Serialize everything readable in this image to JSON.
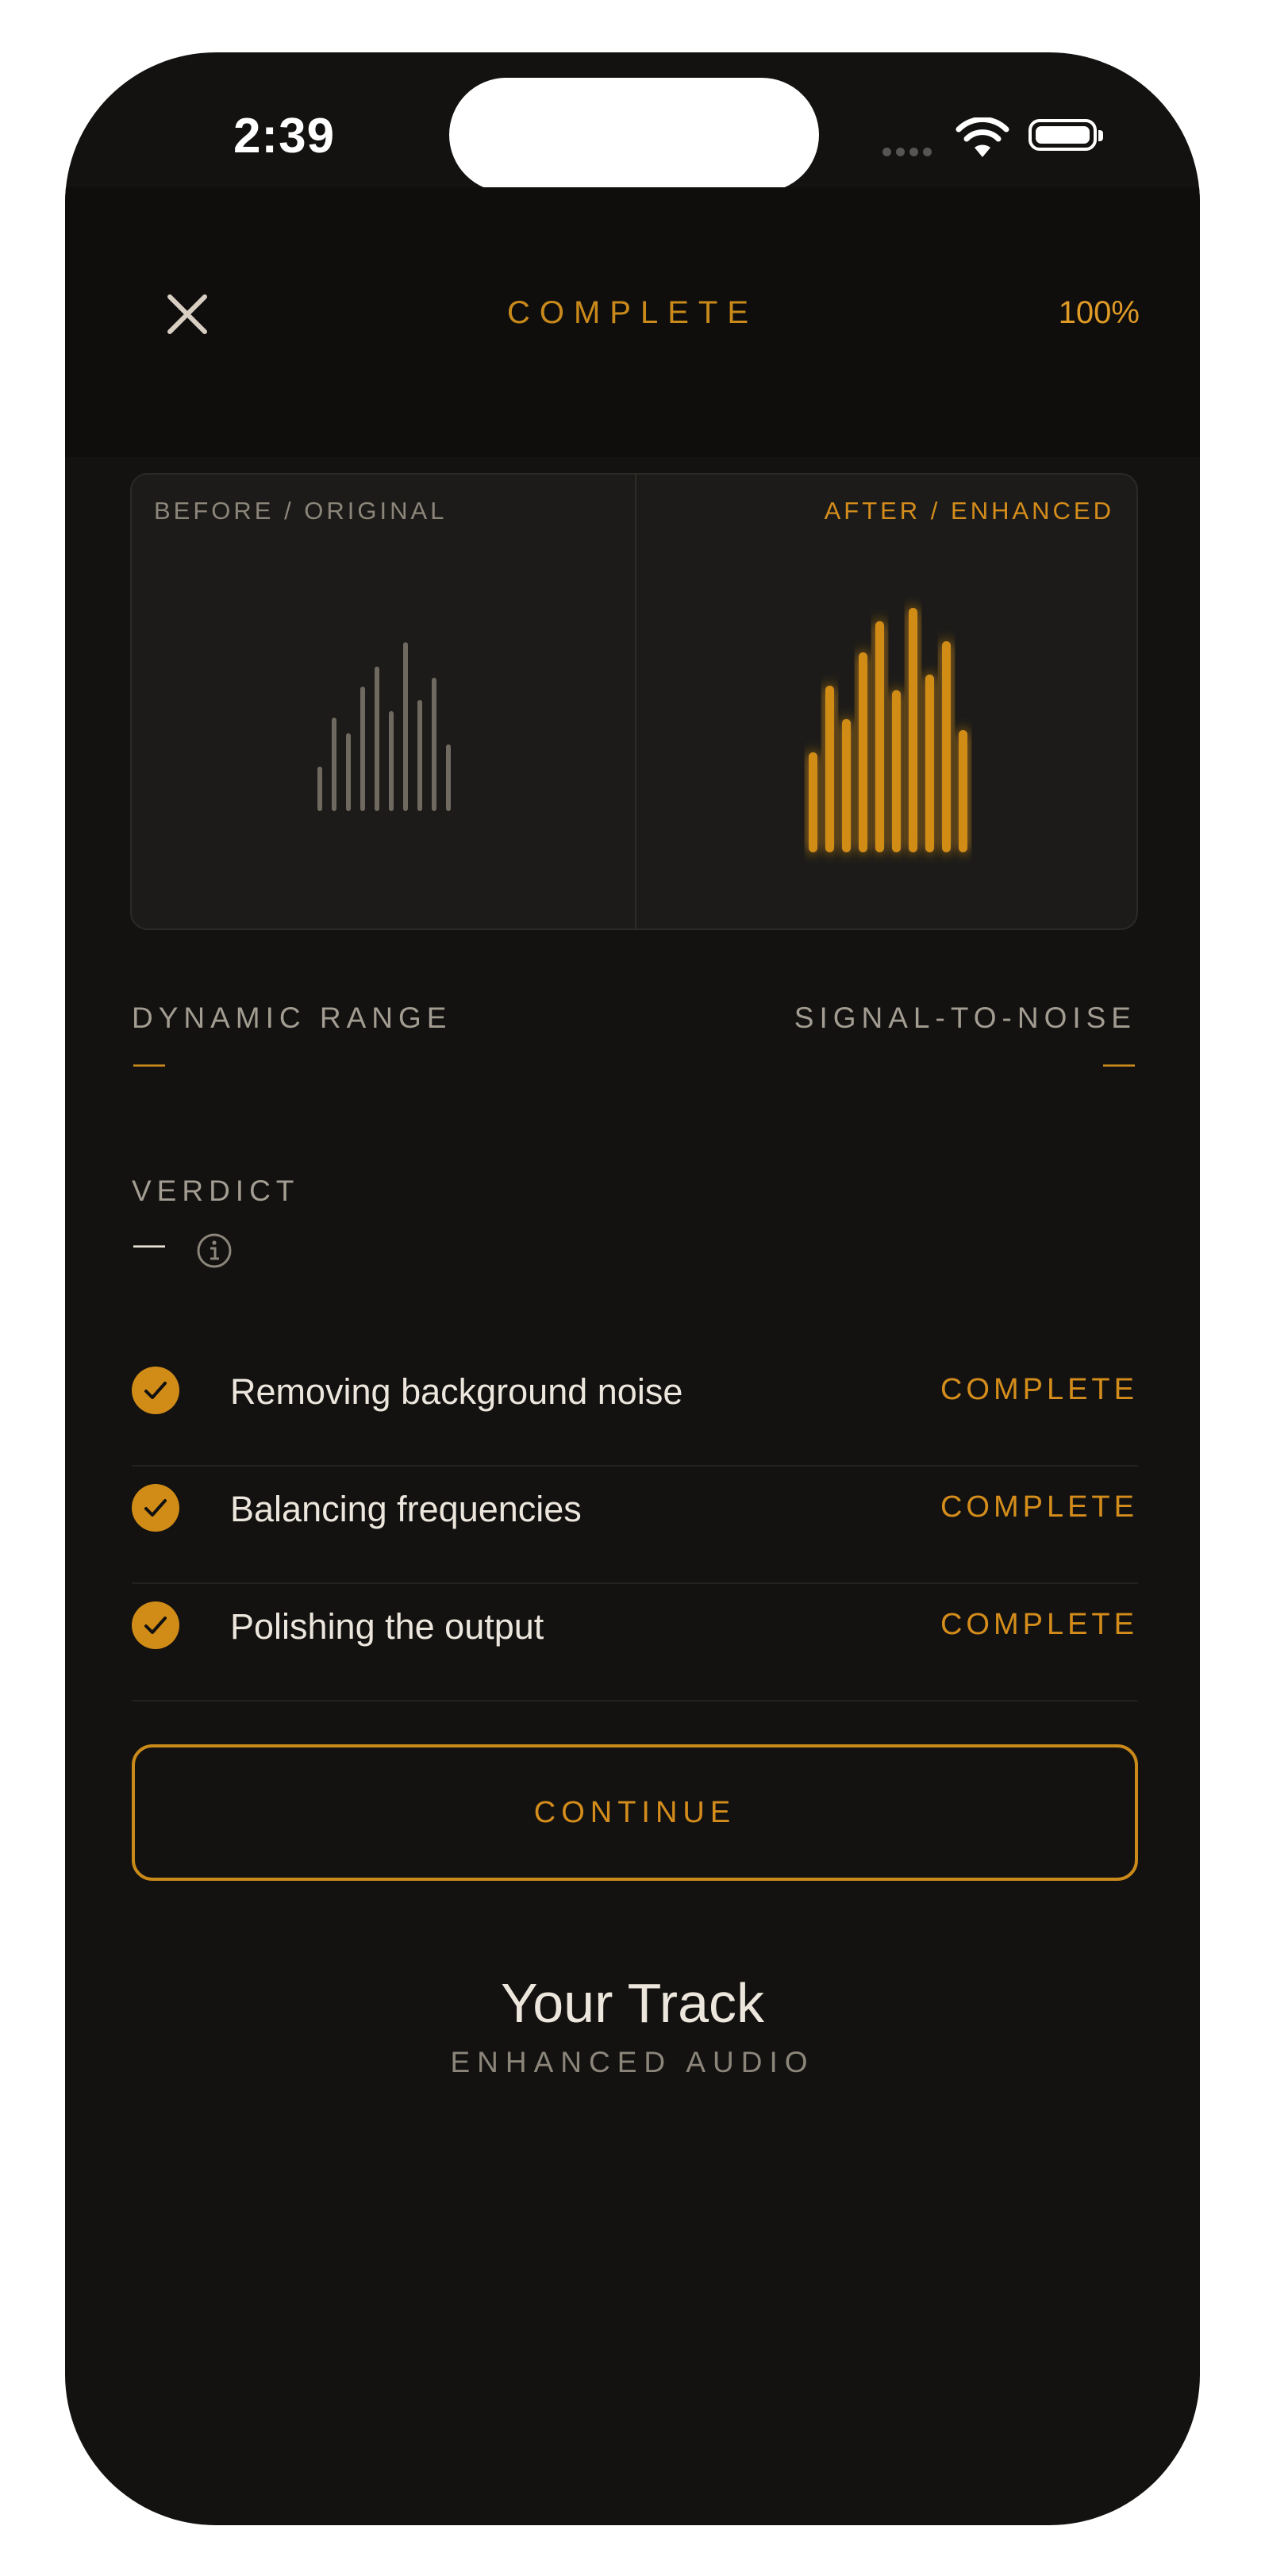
{
  "status_bar": {
    "time": "2:39"
  },
  "header": {
    "title": "COMPLETE",
    "progress": "100%"
  },
  "comparison": {
    "before_label": "BEFORE / ORIGINAL",
    "after_label": "AFTER / ENHANCED",
    "before_levels": [
      0.2,
      0.42,
      0.35,
      0.56,
      0.65,
      0.45,
      0.76,
      0.5,
      0.6,
      0.3
    ],
    "after_levels": [
      0.45,
      0.75,
      0.6,
      0.9,
      1.04,
      0.73,
      1.1,
      0.8,
      0.95,
      0.55
    ],
    "before_color": "#6f6960",
    "after_color": "#d18c18"
  },
  "metrics": {
    "dynamic_range_label": "DYNAMIC RANGE",
    "dynamic_range_value": "—",
    "snr_label": "SIGNAL-TO-NOISE",
    "snr_value": "—"
  },
  "verdict": {
    "label": "VERDICT",
    "value": "—"
  },
  "steps": [
    {
      "name": "Removing background noise",
      "status": "COMPLETE"
    },
    {
      "name": "Balancing frequencies",
      "status": "COMPLETE"
    },
    {
      "name": "Polishing the output",
      "status": "COMPLETE"
    }
  ],
  "continue_label": "CONTINUE",
  "track": {
    "title": "Your Track",
    "subtitle": "ENHANCED AUDIO"
  },
  "colors": {
    "accent": "#d18c18",
    "background": "#131211"
  }
}
